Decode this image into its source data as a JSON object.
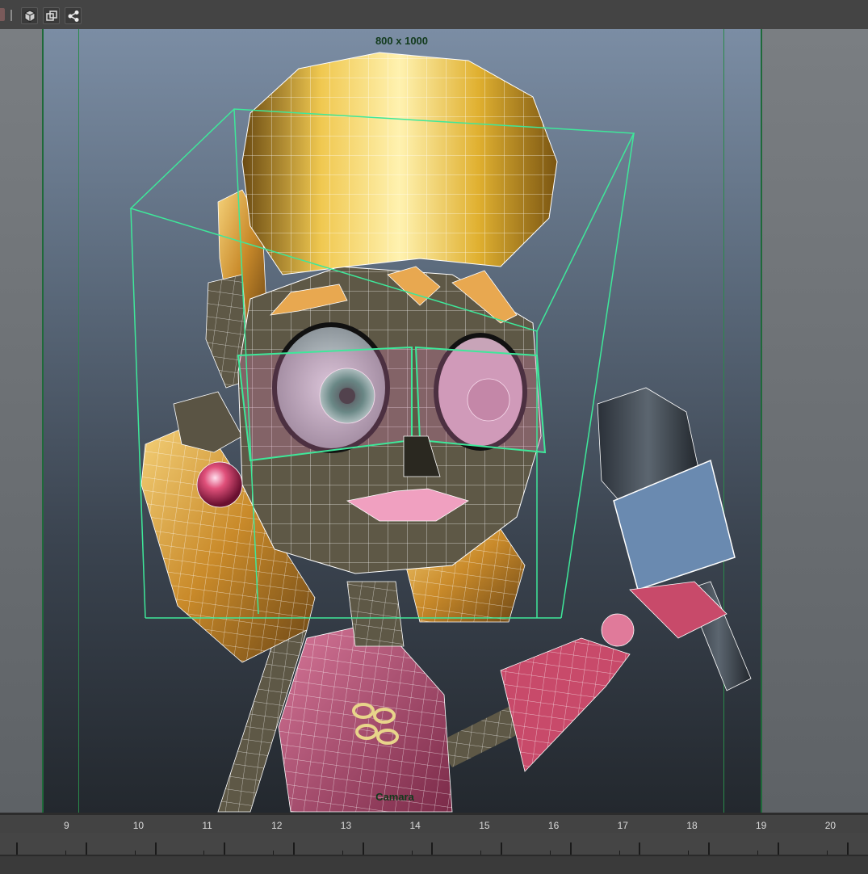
{
  "toolbar": {
    "icons": [
      "display-cube-icon",
      "isolate-icon",
      "share-icon"
    ]
  },
  "viewport": {
    "resolution_label": "800 x 1000",
    "camera_label": "Camara"
  },
  "timeline": {
    "ticks": [
      "9",
      "10",
      "11",
      "12",
      "13",
      "14",
      "15",
      "16",
      "17",
      "18",
      "19",
      "20"
    ]
  },
  "colors": {
    "resolution_gate": "#1f6a3a",
    "selection_wire": "#3ee89a",
    "wireframe": "#ffffff"
  }
}
